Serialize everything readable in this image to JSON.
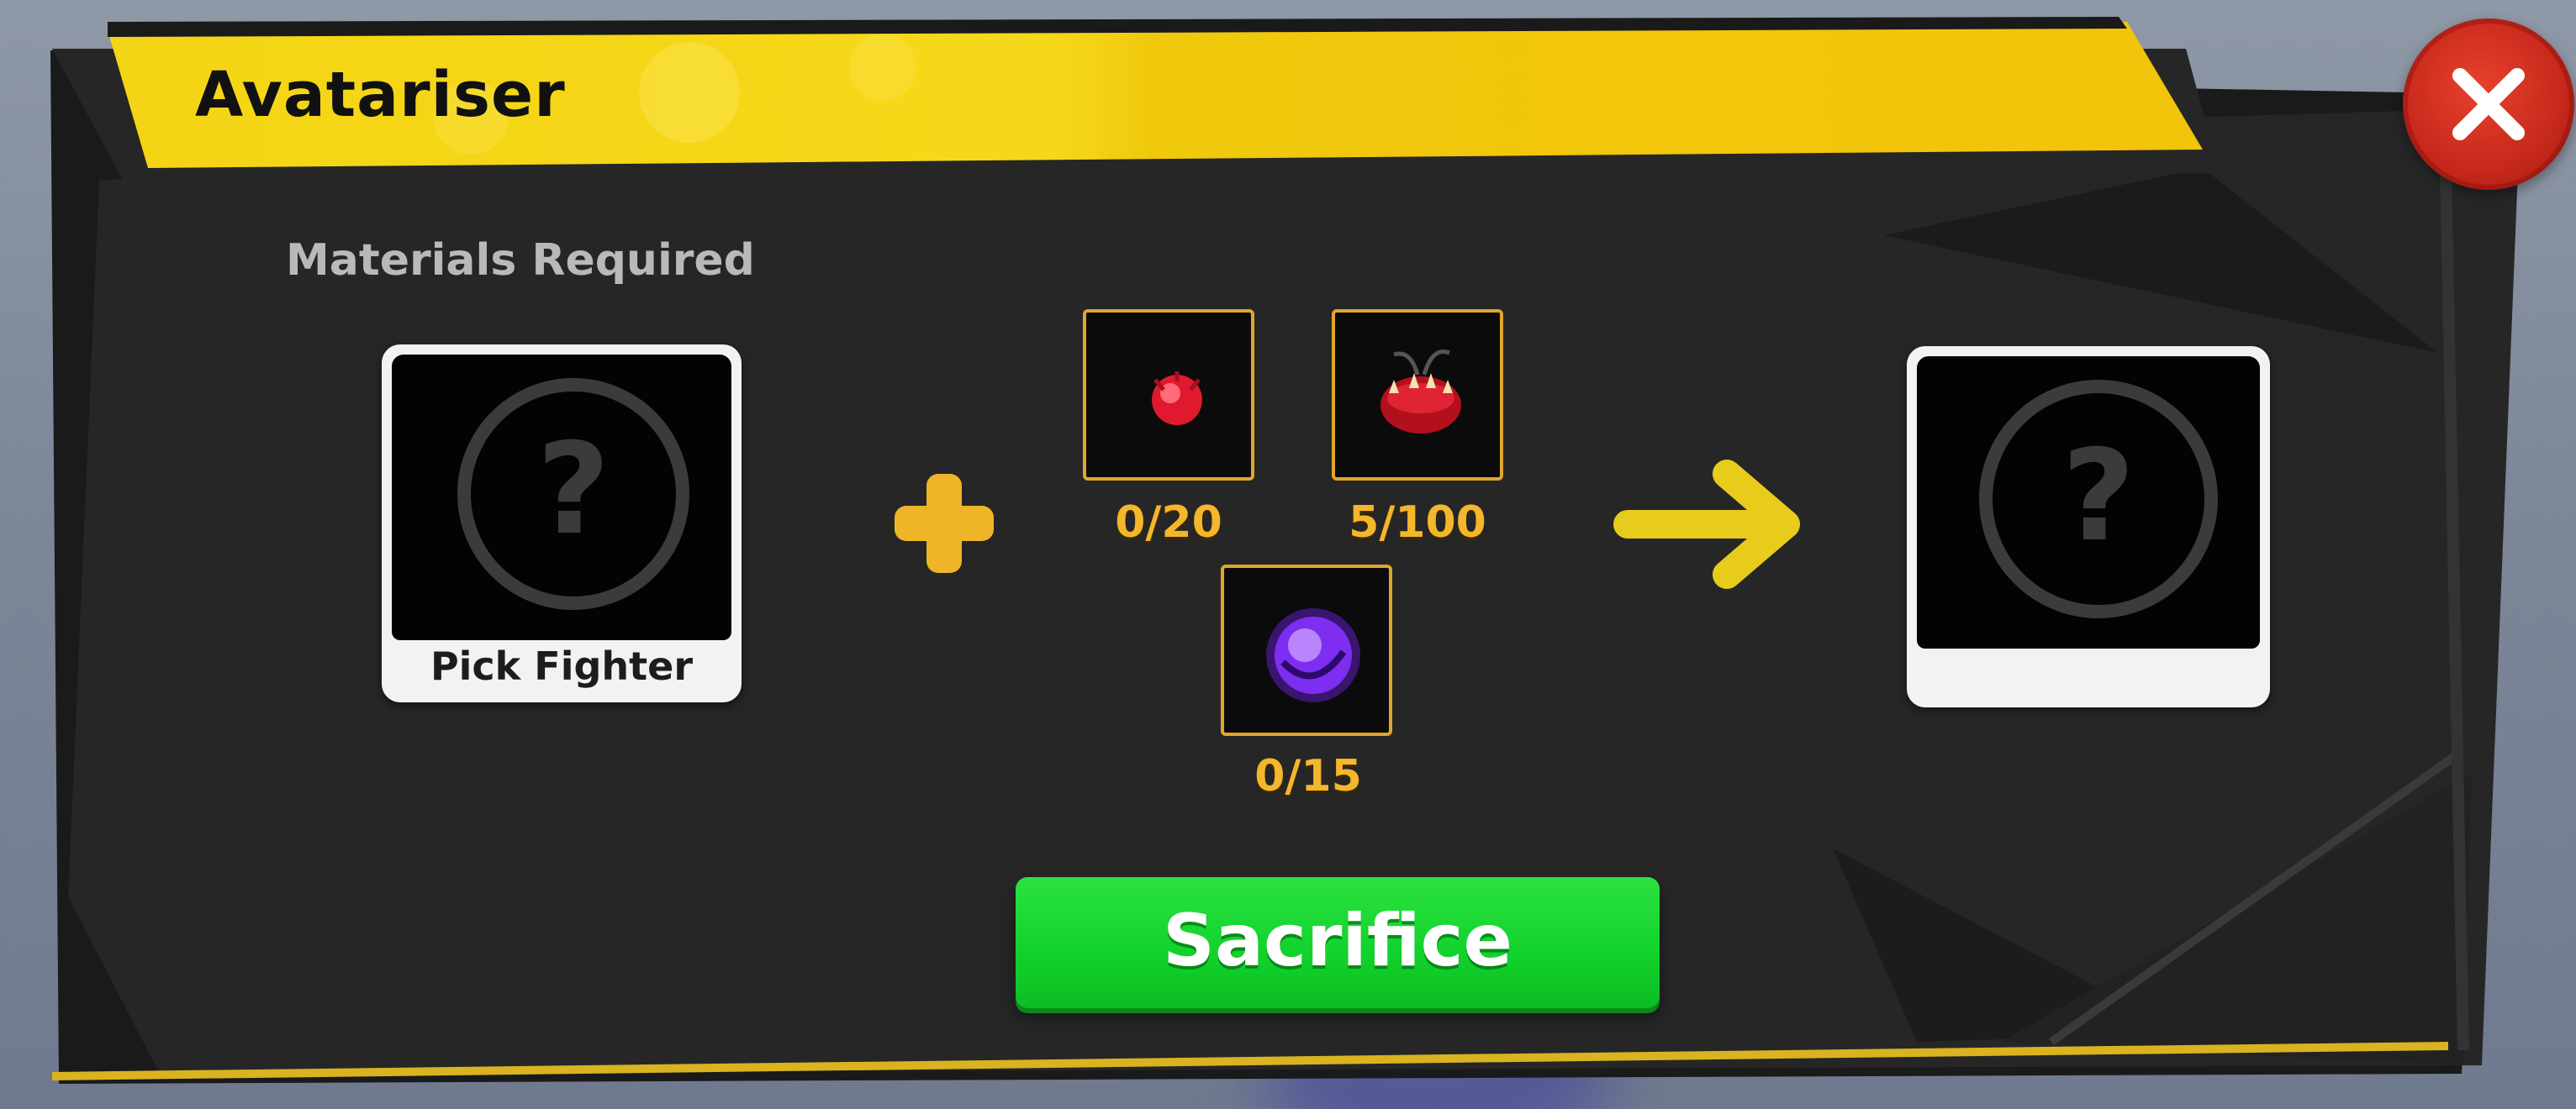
{
  "window": {
    "title": "Avatariser",
    "close_icon": "close-icon"
  },
  "colors": {
    "header_yellow": "#f5d40f",
    "panel_dark": "#262626",
    "close_red": "#d22e1f",
    "material_count": "#f4b62b",
    "action_green": "#16d62e"
  },
  "materials": {
    "label": "Materials Required",
    "fighter_slot": {
      "caption": "Pick Fighter",
      "icon": "question-mark-icon"
    },
    "items": [
      {
        "icon": "red-orb-icon",
        "count": "0/20",
        "have": 0,
        "need": 20
      },
      {
        "icon": "red-fruit-icon",
        "count": "5/100",
        "have": 5,
        "need": 100
      },
      {
        "icon": "purple-orb-icon",
        "count": "0/15",
        "have": 0,
        "need": 15
      }
    ]
  },
  "result": {
    "caption": "",
    "icon": "question-mark-icon"
  },
  "actions": {
    "sacrifice_label": "Sacrifice"
  }
}
